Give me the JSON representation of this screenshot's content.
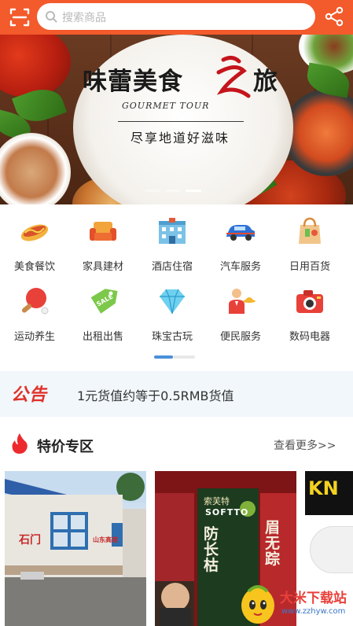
{
  "search": {
    "placeholder": "搜索商品"
  },
  "banner": {
    "title": "味蕾美食",
    "title_end": "旅",
    "subtitle": "GOURMET TOUR",
    "slogan": "尽享地道好滋味",
    "slide_count": 3,
    "active_slide": 2
  },
  "categories": [
    {
      "label": "美食餐饮",
      "icon": "hotdog-icon"
    },
    {
      "label": "家具建材",
      "icon": "sofa-icon"
    },
    {
      "label": "酒店住宿",
      "icon": "hotel-icon"
    },
    {
      "label": "汽车服务",
      "icon": "car-icon"
    },
    {
      "label": "日用百货",
      "icon": "shopping-bag-icon"
    },
    {
      "label": "运动养生",
      "icon": "ping-pong-icon"
    },
    {
      "label": "出租出售",
      "icon": "sale-tag-icon"
    },
    {
      "label": "珠宝古玩",
      "icon": "diamond-icon"
    },
    {
      "label": "便民服务",
      "icon": "waiter-icon"
    },
    {
      "label": "数码电器",
      "icon": "camera-icon"
    }
  ],
  "notice": {
    "tag": "公告",
    "text": "1元货值约等于0.5RMB货值"
  },
  "specials": {
    "title": "特价专区",
    "more": "查看更多>>"
  },
  "products": [
    {
      "sign_left": "石门",
      "sign_right": "山东高速"
    },
    {
      "brand_cn": "索芙特",
      "brand_en": "SOFTTO",
      "product_a": "防长枯",
      "product_b": "眉无踪"
    },
    {
      "text": "KN"
    }
  ],
  "watermark": {
    "name": "大米下载站",
    "url": "www.zzhyw.com"
  },
  "colors": {
    "accent": "#f35a2c",
    "notice_red": "#e0312b",
    "pager_blue": "#4a8fd8"
  }
}
